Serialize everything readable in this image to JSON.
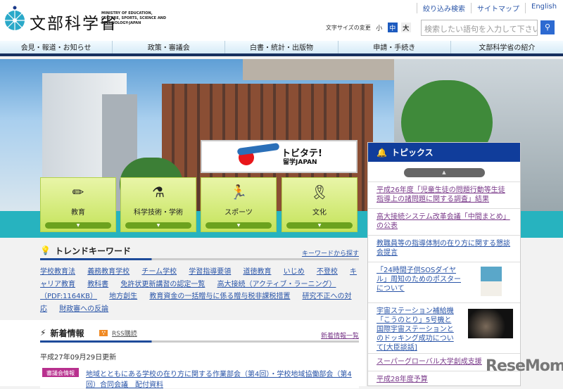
{
  "header": {
    "logo_text": "文部科学省",
    "logo_en": "MINISTRY OF EDUCATION, CULTURE, SPORTS, SCIENCE AND TECHNOLOGY-JAPAN",
    "top_links": [
      "絞り込み検索",
      "サイトマップ",
      "English"
    ],
    "font_size_label": "文字サイズの変更",
    "font_sizes": [
      "小",
      "中",
      "大"
    ],
    "search_placeholder": "検索したい語句を入力して下さい"
  },
  "nav": [
    "会見・報道・お知らせ",
    "政策・審議会",
    "白書・統計・出版物",
    "申請・手続き",
    "文部科学省の紹介"
  ],
  "banner": {
    "title": "トビタテ!",
    "sub": "留学JAPAN"
  },
  "tiles": [
    "教育",
    "科学技術・学術",
    "スポーツ",
    "文化"
  ],
  "trend": {
    "title": "トレンドキーワード",
    "more": "キーワードから探す",
    "keywords": [
      "学校教育法",
      "義務教育学校",
      "チーム学校",
      "学習指導要領",
      "道徳教育",
      "いじめ",
      "不登校",
      "キャリア教育",
      "教科書",
      "免許状更新講習の認定一覧",
      "高大接続（アクティブ・ラーニング）（PDF:1164KB）",
      "地方創生",
      "教育資金の一括贈与に係る贈与税非課税措置",
      "研究不正への対応",
      "財政審への反論"
    ]
  },
  "news": {
    "title": "新着情報",
    "rss": "RSS購読",
    "more": "新着情報一覧",
    "date": "平成27年09月29日更新",
    "badge": "審議会情報",
    "item": "地域とともにある学校の在り方に関する作業部会（第4回）・学校地域協働部会（第4回）合同会議　配付資料"
  },
  "topics": {
    "title": "トピックス",
    "items": [
      "平成26年度「児童生徒の問題行動等生徒指導上の諸問題に関する調査」結果",
      "高大接続システム改革会議「中間まとめ」の公表",
      "教職員等の指導体制の在り方に関する懇談会提言",
      "「24時間子供SOSダイヤル」周知のためのポスターについて",
      "宇宙ステーション補給機「こうのとり」5号機と国際宇宙ステーションとのドッキング成功について[大臣談話]",
      "スーパーグローバル大学創成支援",
      "平成28年度予算"
    ]
  },
  "watermark": "ReseMom"
}
